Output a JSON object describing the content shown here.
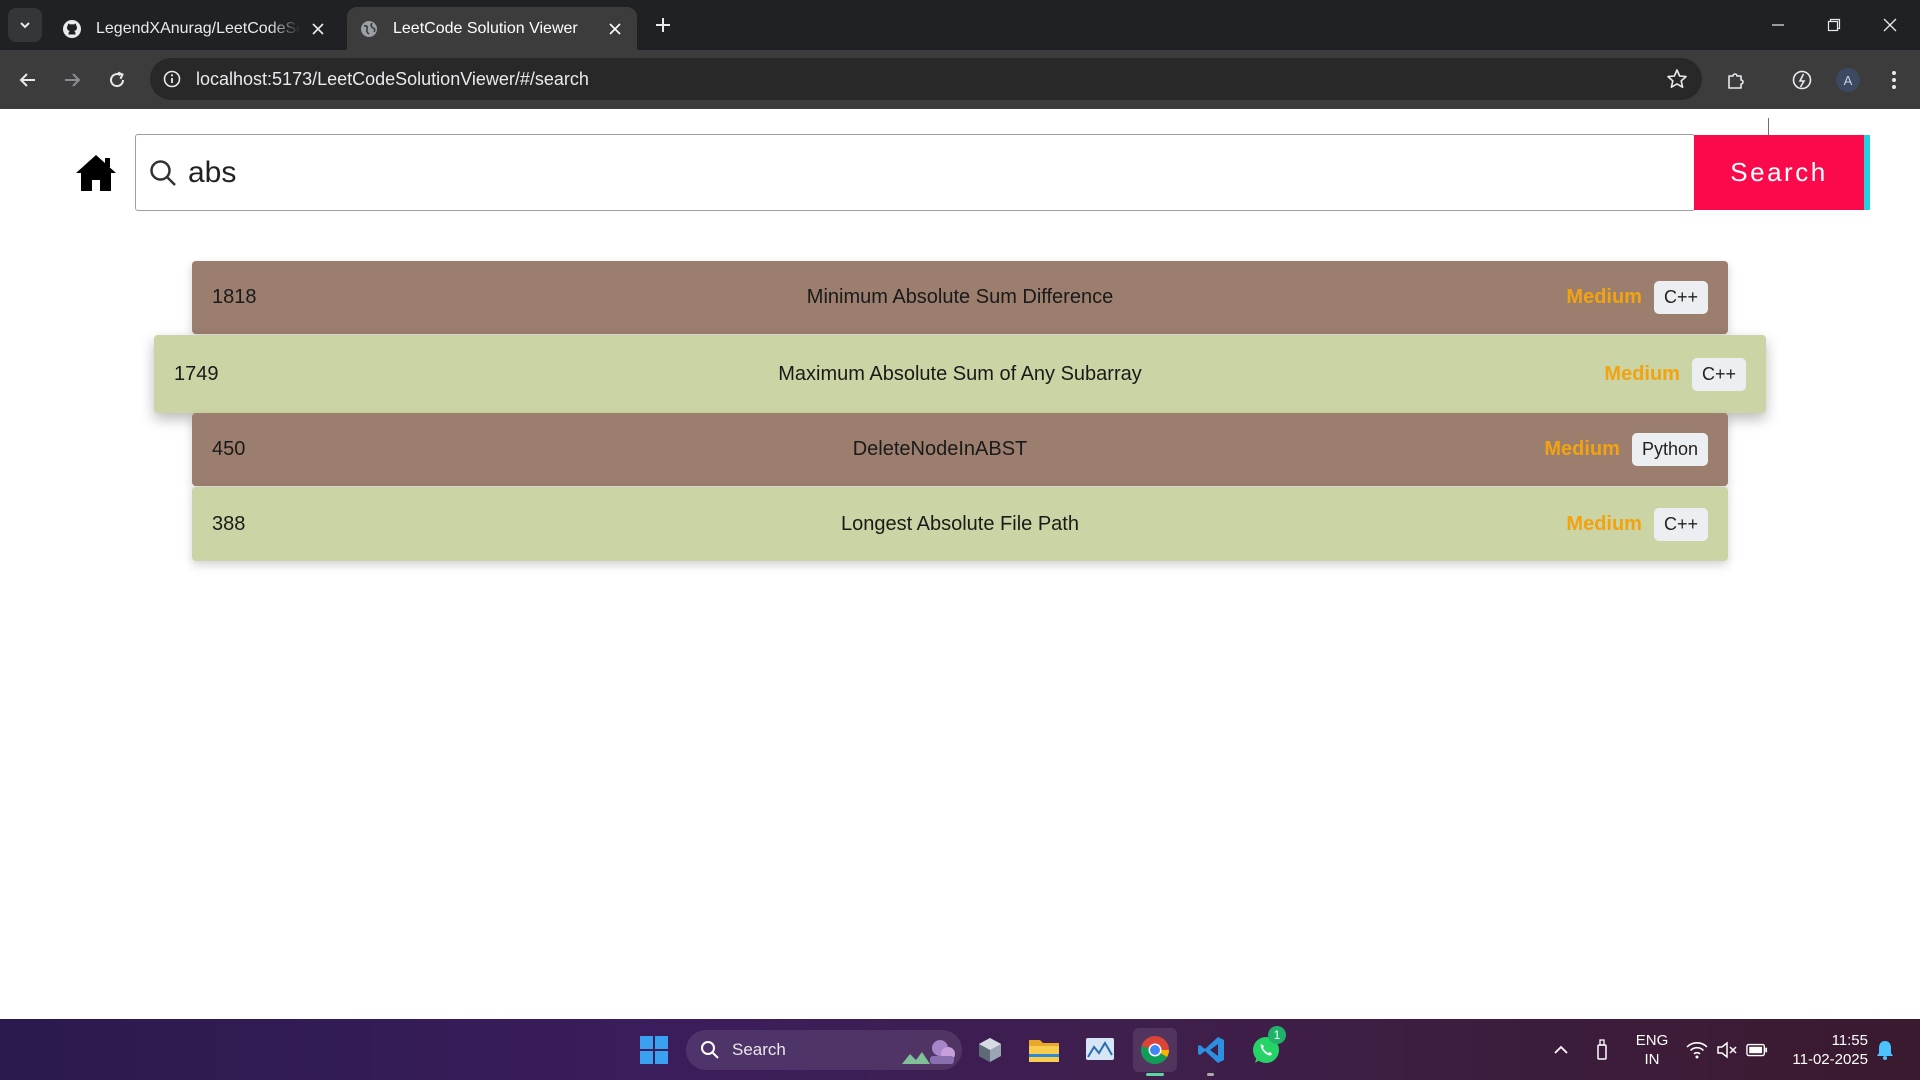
{
  "browser": {
    "tabs": [
      {
        "title": "LegendXAnurag/LeetCodeSolutionViewer",
        "icon": "github-icon",
        "active": false
      },
      {
        "title": "LeetCode Solution Viewer",
        "icon": "globe-icon",
        "active": true
      }
    ],
    "url": "localhost:5173/LeetCodeSolutionViewer/#/search",
    "profile_initial": "A"
  },
  "search": {
    "value": "abs",
    "button_label": "Search"
  },
  "results": [
    {
      "id": "1818",
      "title": "Minimum Absolute Sum Difference",
      "difficulty": "Medium",
      "language": "C++"
    },
    {
      "id": "1749",
      "title": "Maximum Absolute Sum of Any Subarray",
      "difficulty": "Medium",
      "language": "C++"
    },
    {
      "id": "450",
      "title": "DeleteNodeInABST",
      "difficulty": "Medium",
      "language": "Python"
    },
    {
      "id": "388",
      "title": "Longest Absolute File Path",
      "difficulty": "Medium",
      "language": "C++"
    }
  ],
  "colors": {
    "search_button": "#fb0a4b",
    "search_button_accent": "#22d3dd",
    "row_brown": "#9c7e6f",
    "row_green": "#cbd4a4",
    "difficulty_medium": "#f2a30f"
  },
  "taskbar": {
    "search_label": "Search",
    "whatsapp_badge": "1",
    "language_line1": "ENG",
    "language_line2": "IN",
    "time": "11:55",
    "date": "11-02-2025"
  }
}
